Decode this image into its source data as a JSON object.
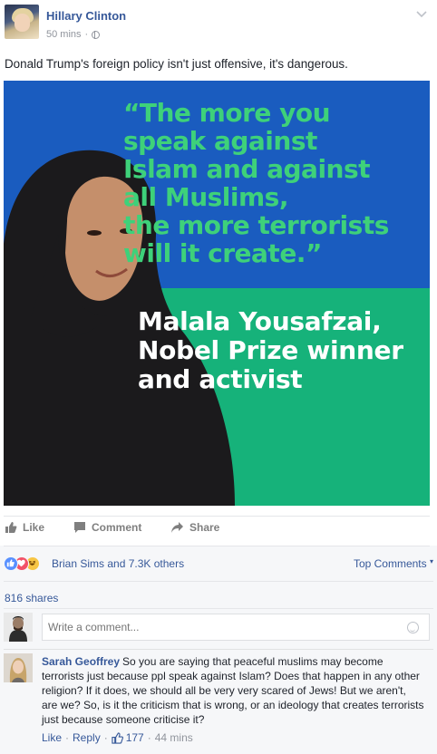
{
  "post": {
    "author": "Hillary Clinton",
    "time": "50 mins",
    "separator": "·",
    "text": "Donald Trump's foreign policy isn't just offensive, it's dangerous."
  },
  "image": {
    "quote_lines": [
      "“The more you",
      "speak against",
      "Islam and against",
      "all Muslims,",
      "the more terrorists",
      "will it create.”"
    ],
    "attribution_lines": [
      "Malala Yousafzai,",
      "Nobel Prize winner",
      "and activist"
    ],
    "colors": {
      "top": "#1a5cbf",
      "bottom": "#16b27a",
      "quote": "#3ed17a",
      "attribution": "#ffffff"
    }
  },
  "actions": {
    "like": "Like",
    "comment": "Comment",
    "share": "Share"
  },
  "reactions": {
    "icons": [
      "like-reaction-icon",
      "love-reaction-icon",
      "haha-reaction-icon"
    ],
    "summary": "Brian Sims and 7.3K others",
    "sort_label": "Top Comments"
  },
  "shares": "816 shares",
  "comment_box": {
    "placeholder": "Write a comment..."
  },
  "comments": [
    {
      "author": "Sarah Geoffrey",
      "text": "So you are saying that peaceful muslims may become terrorists just because ppl speak against Islam? Does that happen in any other religion? If it does, we should all be very very scared of Jews! But we aren't, are we? So, is it the criticism that is wrong, or an ideology that creates terrorists just because someone criticise it?",
      "like_label": "Like",
      "reply_label": "Reply",
      "likes": "177",
      "time": "44 mins",
      "separator": "·"
    }
  ],
  "theme": {
    "link": "#365899",
    "muted": "#90949c",
    "background": "#f6f7f9"
  }
}
